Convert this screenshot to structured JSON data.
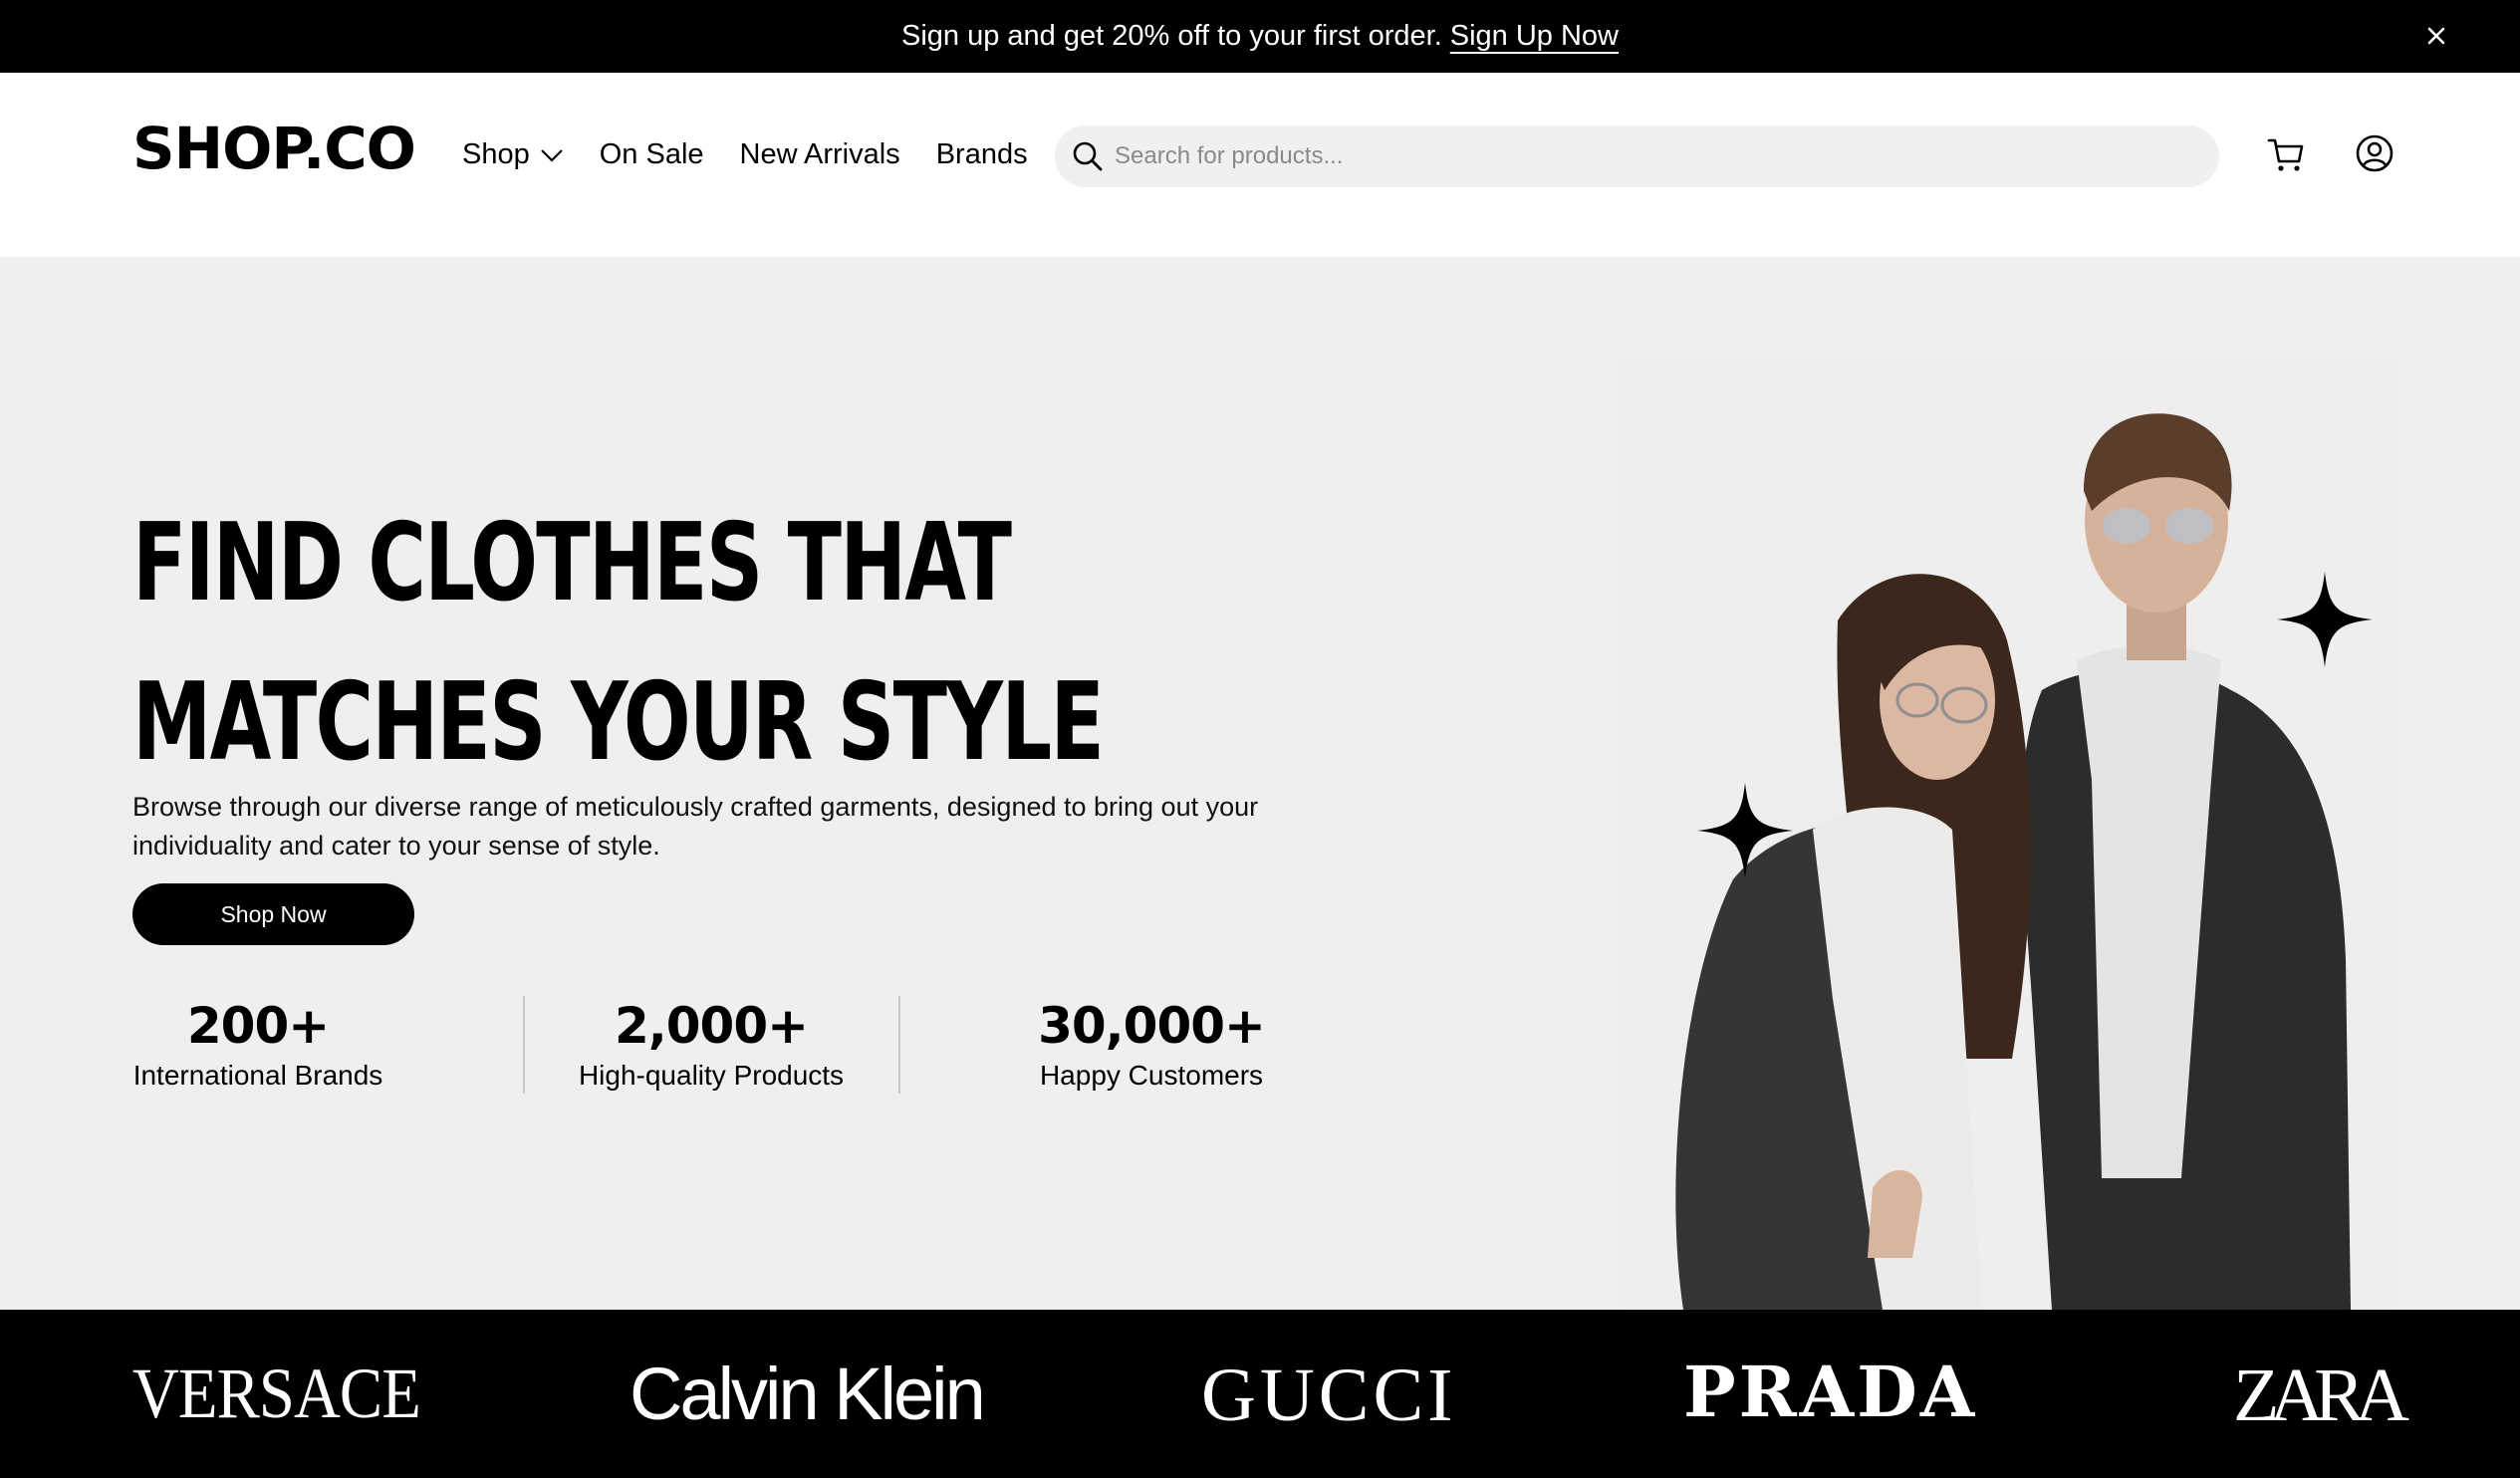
{
  "promo": {
    "text": "Sign up and get 20% off to your first order.",
    "link_label": "Sign Up Now",
    "close_icon": "close-icon"
  },
  "header": {
    "logo": "SHOP.CO",
    "nav": [
      {
        "label": "Shop",
        "has_dropdown": true,
        "icon": "chevron-down-icon"
      },
      {
        "label": "On Sale"
      },
      {
        "label": "New Arrivals"
      },
      {
        "label": "Brands"
      }
    ],
    "search": {
      "placeholder": "Search for products...",
      "value": "",
      "icon": "search-icon"
    },
    "cart_icon": "cart-icon",
    "account_icon": "user-circle-icon"
  },
  "hero": {
    "headline": "FIND CLOTHES THAT MATCHES YOUR STYLE",
    "description": "Browse through our diverse range of meticulously crafted garments, designed to bring out your individuality and cater to your sense of style.",
    "cta_label": "Shop Now",
    "stats": [
      {
        "value": "200+",
        "label": "International Brands"
      },
      {
        "value": "2,000+",
        "label": "High-quality Products"
      },
      {
        "value": "30,000+",
        "label": "Happy Customers"
      }
    ],
    "image": "couple-in-denim-jackets-photo",
    "decoration": "sparkle-star-icon"
  },
  "brands": [
    "VERSACE",
    "Calvin Klein",
    "GUCCI",
    "PRADA",
    "ZARA"
  ],
  "colors": {
    "primary": "#000000",
    "hero_bg": "#f0eff0",
    "search_bg": "#f0f0f0",
    "divider": "#c9c9c9",
    "text_on_dark": "#ffffff"
  }
}
